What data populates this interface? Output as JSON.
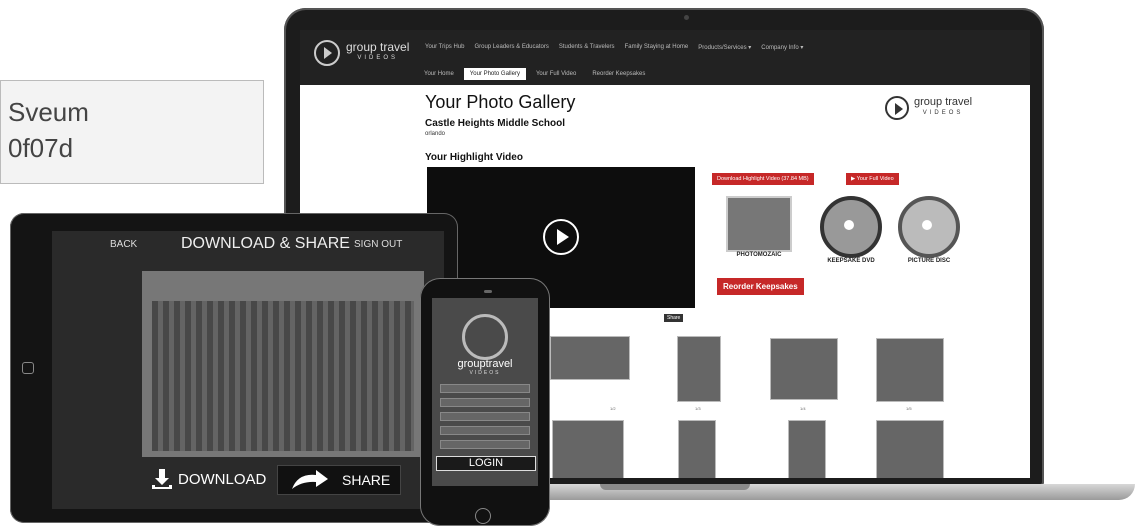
{
  "stamp": {
    "line1": "Sveum",
    "line2": "0f07d"
  },
  "site": {
    "logo": {
      "main": "group travel",
      "sub": "VIDEOS"
    },
    "nav_top": [
      "Your Trips Hub",
      "Group Leaders & Educators",
      "Students & Travelers",
      "Family Staying at Home",
      "Products/Services ▾",
      "Company Info ▾"
    ],
    "nav_tabs": [
      "Your Home",
      "Your Photo Gallery",
      "Your Full Video",
      "Reorder Keepsakes"
    ],
    "page_title": "Your Photo Gallery",
    "school": "Castle Heights Middle School",
    "city": "orlando",
    "highlight_label": "Your Highlight Video",
    "share_tag": "Share",
    "brand_right": {
      "main": "group travel",
      "sub": "VIDEOS"
    },
    "btn_download": "Download Highlight Video (37.84 MB)",
    "btn_full_video": "▶ Your Full Video",
    "keepsakes": [
      "PHOTOMOZAIC",
      "KEEPSAKE DVD",
      "PICTURE DISC"
    ],
    "btn_reorder": "Reorder Keepsakes",
    "thumb_captions": [
      "1/2",
      "1/3",
      "1/4",
      "1/5"
    ]
  },
  "tablet": {
    "back": "BACK",
    "title": "DOWNLOAD & SHARE",
    "signout": "SIGN OUT",
    "download": "DOWNLOAD",
    "share": "SHARE"
  },
  "phone": {
    "brand": "grouptravel",
    "sub": "VIDEOS",
    "login": "LOGIN"
  }
}
